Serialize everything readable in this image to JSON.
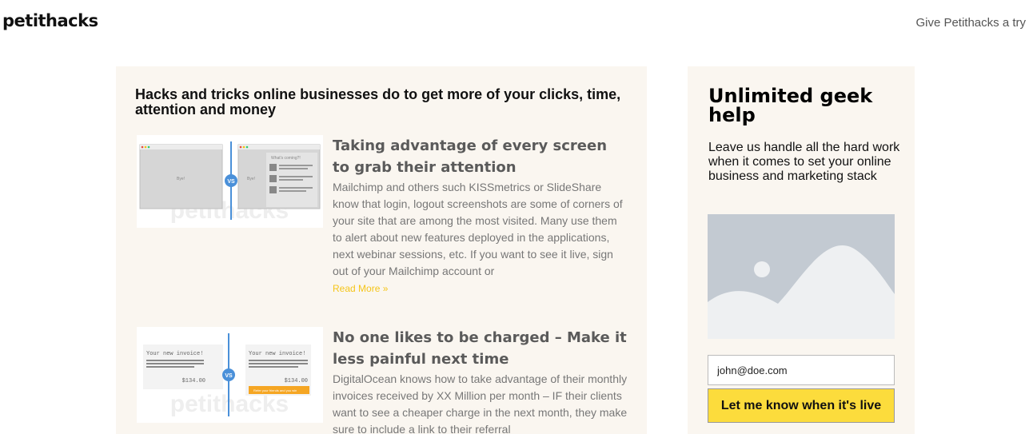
{
  "header": {
    "brand": "petithacks",
    "cta": "Give Petithacks a try"
  },
  "main": {
    "headline": "Hacks and tricks online businesses do to get more of your clicks, time, attention and money",
    "posts": [
      {
        "title": "Taking advantage of every screen to grab their attention",
        "excerpt": "Mailchimp and others such KISSmetrics or SlideShare know that login, logout screenshots are some of corners of your site that are among the most visited. Many use them to alert about new features deployed in the applications, next webinar sessions, etc. If you want to see it live, sign out of your Mailchimp account or",
        "read_more": "Read More »",
        "thumb": {
          "watermark": "petithacks",
          "vs": "VS",
          "label_left": "Bye!",
          "label_right": "Bye!",
          "banner": "What's coming?!"
        }
      },
      {
        "title": "No one likes to be charged – Make it less painful next time",
        "excerpt": "DigitalOcean knows how to take advantage of their monthly invoices received by XX Million per month – IF their clients want to see a cheaper charge in the next month, they make sure to include a link to their referral",
        "thumb": {
          "watermark": "petithacks",
          "vs": "VS",
          "invoice_left": "Your new invoice!",
          "invoice_right": "Your new invoice!",
          "amount_left": "$134.00",
          "amount_right": "$134.00",
          "promo": "Refer your friends and you win"
        }
      }
    ]
  },
  "sidebar": {
    "title": "Unlimited geek help",
    "description": "Leave us handle all the hard work when it comes to set your online business and marketing stack",
    "email_value": "john@doe.com",
    "button": "Let me know when it's live"
  },
  "colors": {
    "panel_bg": "#faf6f0",
    "accent_yellow": "#fcdc3c",
    "read_more": "#f5c518",
    "vs_blue": "#4a90d9"
  }
}
